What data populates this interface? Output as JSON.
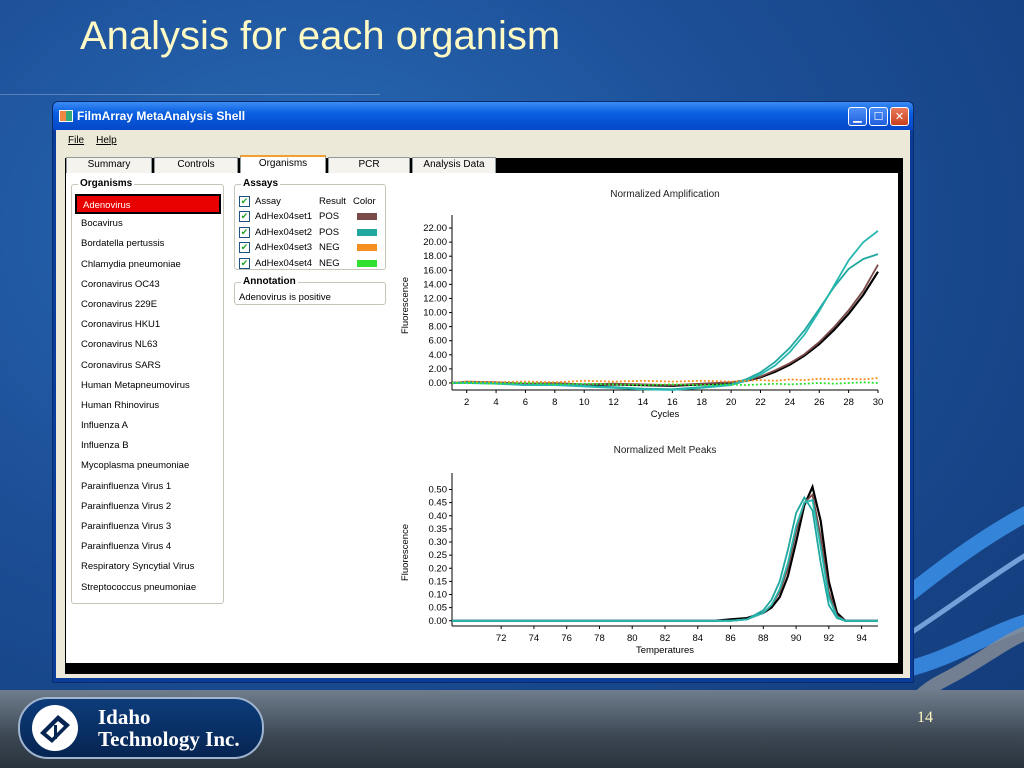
{
  "slide": {
    "title": "Analysis for each organism",
    "page_number": "14",
    "logo": {
      "line1": "Idaho",
      "line2": "Technology Inc."
    }
  },
  "window": {
    "title": "FilmArray MetaAnalysis Shell",
    "menu": {
      "file": "File",
      "help": "Help"
    },
    "tabs": [
      {
        "label": "Summary",
        "active": false
      },
      {
        "label": "Controls",
        "active": false
      },
      {
        "label": "Organisms",
        "active": true
      },
      {
        "label": "PCR",
        "active": false
      },
      {
        "label": "Analysis Data",
        "active": false
      }
    ]
  },
  "organisms": {
    "title": "Organisms",
    "selected": "Adenovirus",
    "items": [
      "Adenovirus",
      "Bocavirus",
      "Bordatella pertussis",
      "Chlamydia pneumoniae",
      "Coronavirus OC43",
      "Coronavirus 229E",
      "Coronavirus HKU1",
      "Coronavirus NL63",
      "Coronavirus SARS",
      "Human Metapneumovirus",
      "Human Rhinovirus",
      "Influenza A",
      "Influenza B",
      "Mycoplasma pneumoniae",
      "Parainfluenza Virus 1",
      "Parainfluenza Virus 2",
      "Parainfluenza Virus 3",
      "Parainfluenza Virus 4",
      "Respiratory Syncytial Virus",
      "Streptococcus pneumoniae"
    ]
  },
  "assays": {
    "title": "Assays",
    "header": {
      "assay": "Assay",
      "result": "Result",
      "color": "Color"
    },
    "rows": [
      {
        "name": "AdHex04set1",
        "result": "POS",
        "color": "#7a4a48",
        "checked": true
      },
      {
        "name": "AdHex04set2",
        "result": "POS",
        "color": "#20a8a0",
        "checked": true
      },
      {
        "name": "AdHex04set3",
        "result": "NEG",
        "color": "#f59020",
        "checked": true
      },
      {
        "name": "AdHex04set4",
        "result": "NEG",
        "color": "#30e030",
        "checked": true
      }
    ]
  },
  "annotation": {
    "title": "Annotation",
    "text": "Adenovirus is positive"
  },
  "chart_data": [
    {
      "type": "line",
      "title": "Normalized Amplification",
      "xlabel": "Cycles",
      "ylabel": "Fluorescence",
      "xlim": [
        1,
        30
      ],
      "ylim": [
        -1,
        23
      ],
      "xticks": [
        2,
        4,
        6,
        8,
        10,
        12,
        14,
        16,
        18,
        20,
        22,
        24,
        26,
        28,
        30
      ],
      "yticks": [
        0,
        2,
        4,
        6,
        8,
        10,
        12,
        14,
        16,
        18,
        20,
        22
      ],
      "grid": false,
      "x": [
        1,
        2,
        4,
        6,
        8,
        10,
        12,
        14,
        16,
        18,
        20,
        21,
        22,
        23,
        24,
        25,
        26,
        27,
        28,
        29,
        30
      ],
      "series": [
        {
          "color": "#000000",
          "values": [
            0,
            0.1,
            0,
            -0.2,
            -0.1,
            -0.3,
            -0.2,
            -0.3,
            -0.4,
            -0.2,
            0,
            0.3,
            0.8,
            1.6,
            2.6,
            3.9,
            5.5,
            7.5,
            9.8,
            12.5,
            15.8
          ]
        },
        {
          "color": "#7a4a48",
          "values": [
            0,
            0.2,
            0.1,
            -0.1,
            0,
            -0.2,
            -0.1,
            -0.2,
            -0.3,
            -0.1,
            0.1,
            0.4,
            0.9,
            1.8,
            2.8,
            4.1,
            5.8,
            7.9,
            10.3,
            13.1,
            16.8
          ]
        },
        {
          "color": "#20a8a0",
          "values": [
            0,
            0.1,
            0,
            -0.3,
            -0.2,
            -0.4,
            -0.6,
            -0.8,
            -0.9,
            -0.6,
            -0.2,
            0.5,
            1.5,
            3.0,
            5.0,
            7.5,
            10.5,
            13.6,
            16.2,
            17.6,
            18.3
          ]
        },
        {
          "color": "#28b8b0",
          "values": [
            0,
            0,
            -0.1,
            -0.3,
            -0.3,
            -0.5,
            -0.7,
            -0.9,
            -1.0,
            -0.7,
            -0.3,
            0.3,
            1.2,
            2.5,
            4.4,
            6.9,
            10.2,
            13.8,
            17.4,
            20.0,
            21.6
          ]
        },
        {
          "color": "#f59020",
          "values": [
            0,
            0.2,
            0.1,
            0.2,
            0.1,
            0.3,
            0.2,
            0.3,
            0.2,
            0.3,
            0.2,
            0.3,
            0.4,
            0.3,
            0.5,
            0.4,
            0.6,
            0.5,
            0.6,
            0.5,
            0.7
          ]
        },
        {
          "color": "#30e030",
          "values": [
            0,
            0,
            -0.1,
            0,
            -0.2,
            -0.1,
            -0.2,
            -0.3,
            -0.2,
            -0.3,
            -0.2,
            -0.3,
            -0.2,
            -0.1,
            -0.2,
            -0.1,
            0,
            -0.1,
            0,
            0.1,
            0
          ]
        }
      ]
    },
    {
      "type": "line",
      "title": "Normalized Melt Peaks",
      "xlabel": "Temperatures",
      "ylabel": "Fluorescence",
      "xlim": [
        69,
        95
      ],
      "ylim": [
        -0.02,
        0.54
      ],
      "xticks": [
        72,
        74,
        76,
        78,
        80,
        82,
        84,
        86,
        88,
        90,
        92,
        94
      ],
      "yticks": [
        0,
        0.05,
        0.1,
        0.15,
        0.2,
        0.25,
        0.3,
        0.35,
        0.4,
        0.45,
        0.5
      ],
      "grid": false,
      "x": [
        69,
        85,
        86,
        87,
        88,
        88.5,
        89,
        89.5,
        90,
        90.5,
        91,
        91.5,
        92,
        92.5,
        93,
        95
      ],
      "series": [
        {
          "color": "#000000",
          "values": [
            0,
            0,
            0.005,
            0.01,
            0.03,
            0.05,
            0.09,
            0.17,
            0.3,
            0.44,
            0.51,
            0.38,
            0.15,
            0.03,
            0,
            0
          ]
        },
        {
          "color": "#7a4a48",
          "values": [
            0,
            0,
            0,
            0.005,
            0.03,
            0.06,
            0.11,
            0.2,
            0.34,
            0.45,
            0.48,
            0.32,
            0.11,
            0.02,
            0,
            0
          ]
        },
        {
          "color": "#20a8a0",
          "values": [
            0,
            0,
            0,
            0.005,
            0.04,
            0.08,
            0.15,
            0.27,
            0.41,
            0.47,
            0.42,
            0.22,
            0.06,
            0.01,
            0,
            0
          ]
        },
        {
          "color": "#28b8b0",
          "values": [
            0,
            0,
            0,
            0.005,
            0.03,
            0.06,
            0.12,
            0.22,
            0.36,
            0.45,
            0.46,
            0.28,
            0.09,
            0.015,
            0,
            0
          ]
        }
      ]
    }
  ]
}
